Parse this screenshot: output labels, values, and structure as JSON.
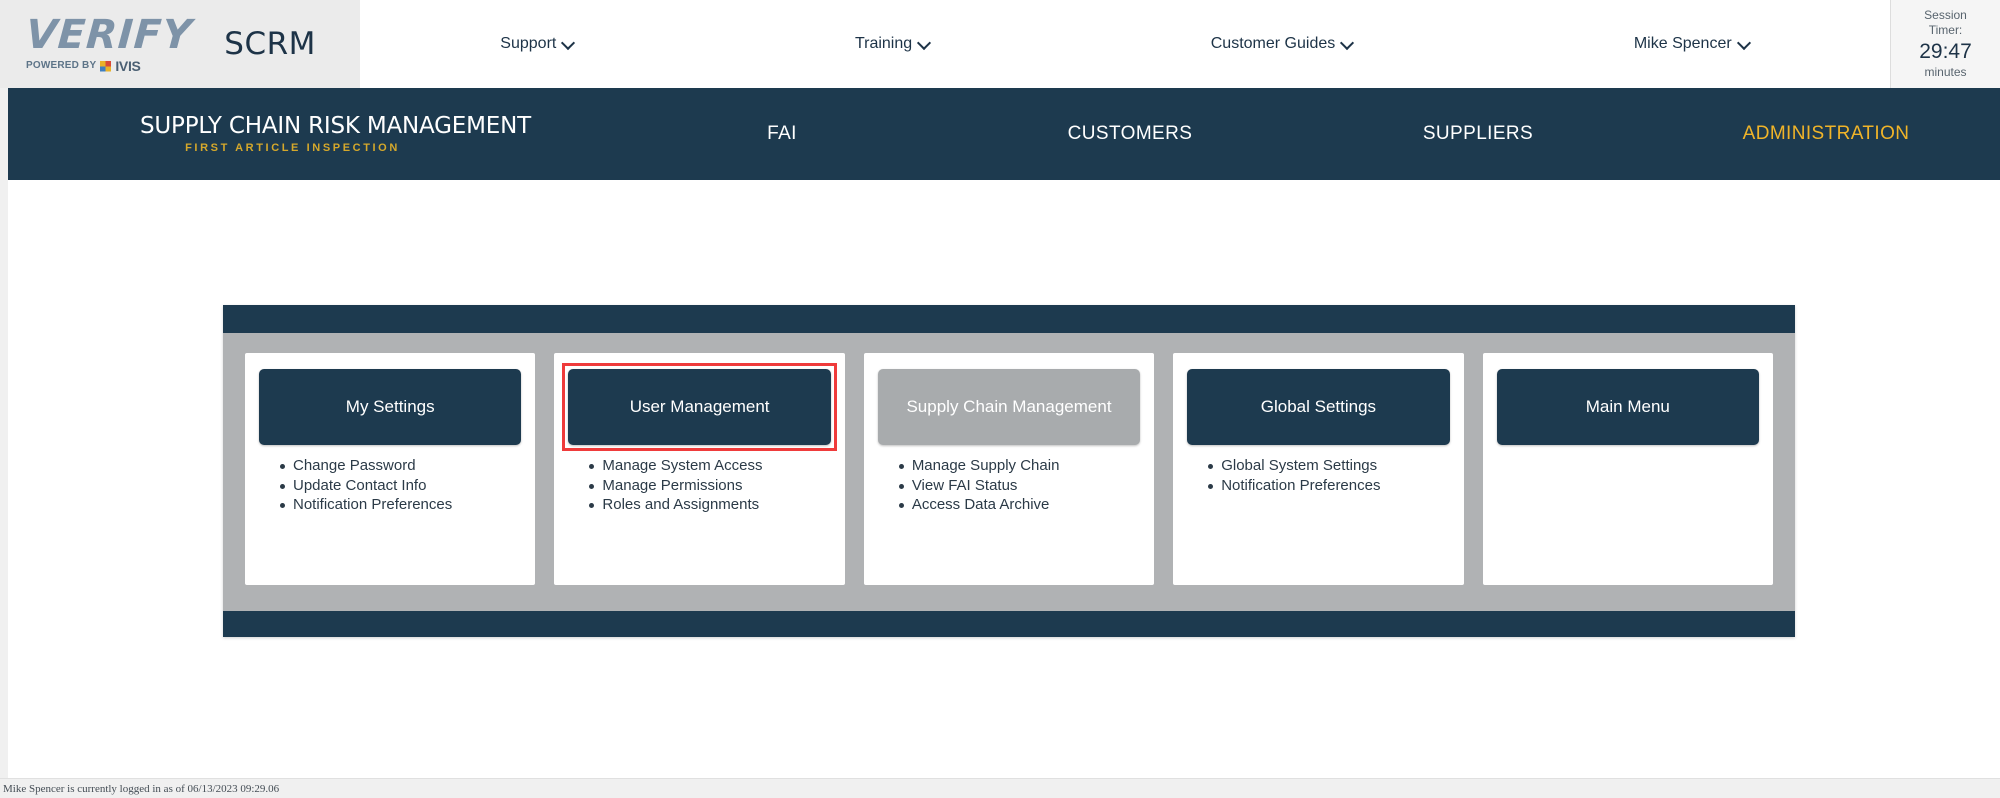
{
  "header": {
    "logo_word": "VERIFY",
    "logo_powered_by": "POWERED BY",
    "logo_ivis": "IVIS",
    "product": "SCRM",
    "nav": [
      {
        "label": "Support",
        "icon": "chevron-down-icon"
      },
      {
        "label": "Training",
        "icon": "chevron-down-icon"
      },
      {
        "label": "Customer Guides",
        "icon": "chevron-down-icon"
      },
      {
        "label": "Mike Spencer",
        "icon": "chevron-down-icon"
      }
    ],
    "session": {
      "label_line1": "Session",
      "label_line2": "Timer:",
      "time": "29:47",
      "unit": "minutes"
    }
  },
  "appnav": {
    "brand_title": "SUPPLY CHAIN RISK MANAGEMENT",
    "brand_subtitle": "FIRST ARTICLE INSPECTION",
    "tabs": [
      {
        "label": "FAI",
        "active": false
      },
      {
        "label": "CUSTOMERS",
        "active": false
      },
      {
        "label": "SUPPLIERS",
        "active": false
      },
      {
        "label": "ADMINISTRATION",
        "active": true
      }
    ],
    "active_color": "#f0b429",
    "bar_color": "#1d3a4f"
  },
  "main": {
    "cards": [
      {
        "button_label": "My Settings",
        "state": "enabled",
        "highlighted": false,
        "items": [
          "Change Password",
          "Update Contact Info",
          "Notification Preferences"
        ]
      },
      {
        "button_label": "User Management",
        "state": "enabled",
        "highlighted": true,
        "highlight_color": "#ef3b3b",
        "items": [
          "Manage System Access",
          "Manage Permissions",
          "Roles and Assignments"
        ]
      },
      {
        "button_label": "Supply Chain Management",
        "state": "disabled",
        "highlighted": false,
        "items": [
          "Manage Supply Chain",
          "View FAI Status",
          "Access Data Archive"
        ]
      },
      {
        "button_label": "Global Settings",
        "state": "enabled",
        "highlighted": false,
        "items": [
          "Global System Settings",
          "Notification Preferences"
        ]
      },
      {
        "button_label": "Main Menu",
        "state": "enabled",
        "highlighted": false,
        "items": []
      }
    ]
  },
  "footer": {
    "status": "Mike Spencer is currently logged in as of 06/13/2023 09:29.06"
  }
}
